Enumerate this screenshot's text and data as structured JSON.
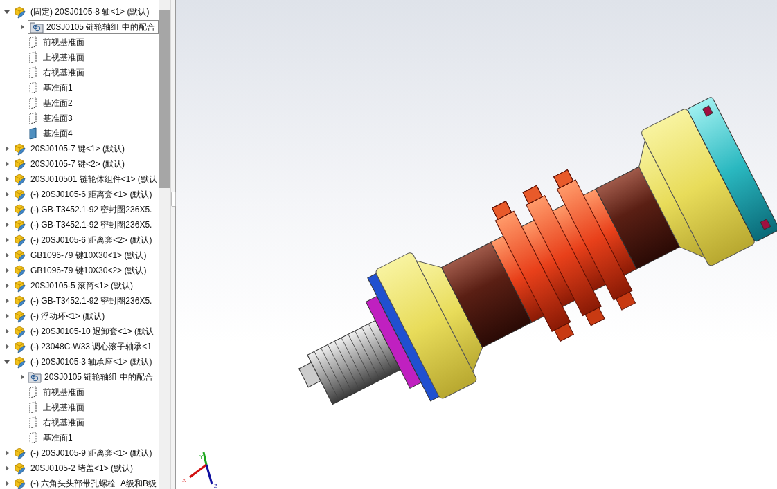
{
  "feature_tree": {
    "items": [
      {
        "kind": "component",
        "label": "(固定) 20SJ0105-8 轴<1> (默认)",
        "expanded": true,
        "children": [
          {
            "kind": "mates",
            "label": "20SJ0105 链轮轴组 中的配合",
            "selected": true,
            "expanded": false
          },
          {
            "kind": "plane",
            "label": "前视基准面",
            "shown": false
          },
          {
            "kind": "plane",
            "label": "上视基准面",
            "shown": false
          },
          {
            "kind": "plane",
            "label": "右视基准面",
            "shown": false
          },
          {
            "kind": "plane",
            "label": "基准面1",
            "shown": false
          },
          {
            "kind": "plane",
            "label": "基准面2",
            "shown": false
          },
          {
            "kind": "plane",
            "label": "基准面3",
            "shown": false
          },
          {
            "kind": "plane",
            "label": "基准面4",
            "shown": true
          }
        ]
      },
      {
        "kind": "component",
        "label": "20SJ0105-7 键<1> (默认)",
        "expanded": false
      },
      {
        "kind": "component",
        "label": "20SJ0105-7 键<2> (默认)",
        "expanded": false
      },
      {
        "kind": "component",
        "label": "20SJ010501 链轮体组件<1> (默认",
        "expanded": false
      },
      {
        "kind": "component",
        "label": "(-) 20SJ0105-6 距离套<1> (默认)",
        "expanded": false
      },
      {
        "kind": "component",
        "label": "(-) GB-T3452.1-92 密封圈236X5.",
        "expanded": false
      },
      {
        "kind": "component",
        "label": "(-) GB-T3452.1-92 密封圈236X5.",
        "expanded": false
      },
      {
        "kind": "component",
        "label": "(-) 20SJ0105-6 距离套<2> (默认)",
        "expanded": false
      },
      {
        "kind": "component",
        "label": "GB1096-79 键10X30<1> (默认)",
        "expanded": false
      },
      {
        "kind": "component",
        "label": "GB1096-79 键10X30<2> (默认)",
        "expanded": false
      },
      {
        "kind": "component",
        "label": "20SJ0105-5 滚筒<1> (默认)",
        "expanded": false
      },
      {
        "kind": "component",
        "label": "(-) GB-T3452.1-92 密封圈236X5.",
        "expanded": false
      },
      {
        "kind": "component",
        "label": "(-) 浮动环<1> (默认)",
        "expanded": false
      },
      {
        "kind": "component",
        "label": "(-) 20SJ0105-10 退卸套<1> (默认",
        "expanded": false
      },
      {
        "kind": "component",
        "label": "(-) 23048C-W33 调心滚子轴承<1",
        "expanded": false
      },
      {
        "kind": "component",
        "label": "(-) 20SJ0105-3 轴承座<1> (默认)",
        "expanded": true,
        "children": [
          {
            "kind": "mates",
            "label": "20SJ0105 链轮轴组 中的配合",
            "selected": false,
            "expanded": false
          },
          {
            "kind": "plane",
            "label": "前视基准面",
            "shown": false
          },
          {
            "kind": "plane",
            "label": "上视基准面",
            "shown": false
          },
          {
            "kind": "plane",
            "label": "右视基准面",
            "shown": false
          },
          {
            "kind": "plane",
            "label": "基准面1",
            "shown": false
          }
        ]
      },
      {
        "kind": "component",
        "label": "(-) 20SJ0105-9 距离套<1> (默认)",
        "expanded": false
      },
      {
        "kind": "component",
        "label": "20SJ0105-2 堵盖<1> (默认)",
        "expanded": false
      },
      {
        "kind": "component",
        "label": "(-) 六角头头部带孔螺栓_A级和B级",
        "expanded": false
      }
    ]
  },
  "viewport": {
    "triad": {
      "x": "X",
      "y": "Y",
      "z": "Z"
    }
  }
}
